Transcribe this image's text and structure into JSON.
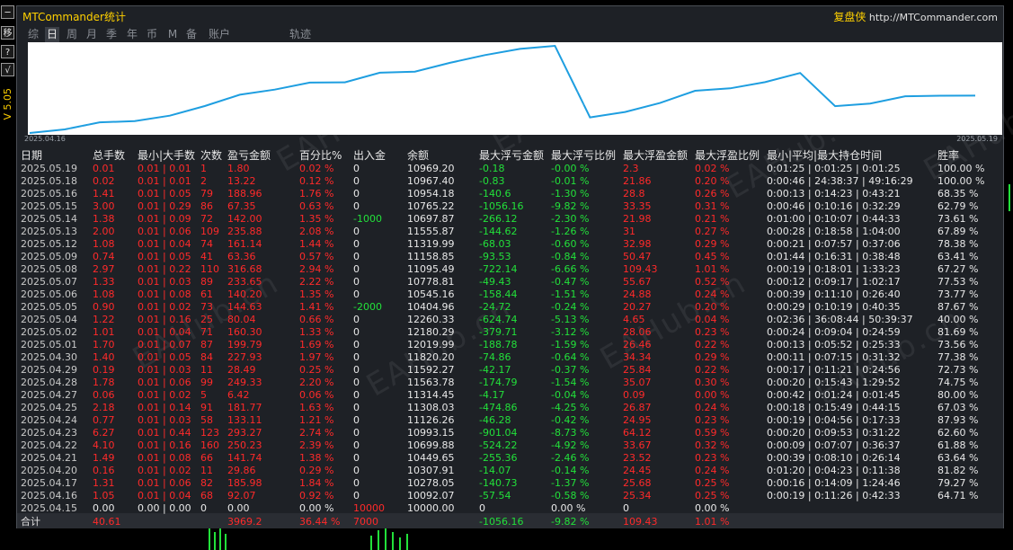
{
  "window": {
    "title": "MTCommander统计",
    "brand_cn": "复盘侠",
    "brand_url": "http://MTCommander.com",
    "version": "V 5.05"
  },
  "sidebar": {
    "buttons": [
      "─",
      "移",
      "?",
      "√"
    ]
  },
  "tabs": [
    {
      "label": "综",
      "active": false
    },
    {
      "label": "日",
      "active": true
    },
    {
      "label": "周",
      "active": false
    },
    {
      "label": "月",
      "active": false
    },
    {
      "label": "季",
      "active": false
    },
    {
      "label": "年",
      "active": false
    },
    {
      "label": "币",
      "active": false
    },
    {
      "label": "M",
      "active": false
    },
    {
      "label": "备",
      "active": false
    },
    {
      "label": "账户",
      "active": false
    },
    {
      "label": "轨迹",
      "active": false
    }
  ],
  "chart_data": {
    "type": "line",
    "x_start_label": "2025.04.16",
    "x_end_label": "2025.05.19",
    "x": [
      "2025.04.15",
      "2025.04.16",
      "2025.04.17",
      "2025.04.20",
      "2025.04.21",
      "2025.04.22",
      "2025.04.23",
      "2025.04.24",
      "2025.04.25",
      "2025.04.27",
      "2025.04.28",
      "2025.04.29",
      "2025.04.30",
      "2025.05.01",
      "2025.05.02",
      "2025.05.04",
      "2025.05.05",
      "2025.05.06",
      "2025.05.07",
      "2025.05.08",
      "2025.05.09",
      "2025.05.12",
      "2025.05.13",
      "2025.05.14",
      "2025.05.15",
      "2025.05.16",
      "2025.05.18",
      "2025.05.19"
    ],
    "values": [
      10000.0,
      10092.07,
      10278.05,
      10307.91,
      10449.65,
      10699.88,
      10993.15,
      11126.26,
      11308.03,
      11314.45,
      11563.78,
      11592.27,
      11820.2,
      12019.99,
      12180.29,
      12260.33,
      10404.96,
      10545.16,
      10778.81,
      11095.49,
      11158.85,
      11319.99,
      11555.87,
      10697.87,
      10765.22,
      10954.18,
      10967.4,
      10969.2
    ],
    "line_color": "#1e9ee0",
    "grid": false
  },
  "watermark": "EAHub.cn",
  "table": {
    "headers": [
      "日期",
      "总手数",
      "最小|大手数",
      "次数",
      "盈亏金额",
      "百分比%",
      "出入金",
      "余额",
      "最大浮亏金额",
      "最大浮亏比例",
      "最大浮盈金额",
      "最大浮盈比例",
      "最小|平均|最大持仓时间",
      "胜率"
    ],
    "rows": [
      [
        "2025.05.19",
        "0.01",
        "0.01 | 0.01",
        "1",
        "1.80",
        "0.02 %",
        "0",
        "10969.20",
        "-0.18",
        "-0.00 %",
        "2.3",
        "0.02 %",
        "0:01:25 | 0:01:25 | 0:01:25",
        "100.00 %"
      ],
      [
        "2025.05.18",
        "0.02",
        "0.01 | 0.01",
        "2",
        "13.22",
        "0.12 %",
        "0",
        "10967.40",
        "-0.83",
        "-0.01 %",
        "21.86",
        "0.20 %",
        "0:00:46 | 24:38:37 | 49:16:29",
        "100.00 %"
      ],
      [
        "2025.05.16",
        "1.41",
        "0.01 | 0.05",
        "79",
        "188.96",
        "1.76 %",
        "0",
        "10954.18",
        "-140.6",
        "-1.30 %",
        "28.8",
        "0.26 %",
        "0:00:13 | 0:14:23 | 0:43:21",
        "68.35 %"
      ],
      [
        "2025.05.15",
        "3.00",
        "0.01 | 0.29",
        "86",
        "67.35",
        "0.63 %",
        "0",
        "10765.22",
        "-1056.16",
        "-9.82 %",
        "33.35",
        "0.31 %",
        "0:00:46 | 0:10:16 | 0:32:29",
        "62.79 %"
      ],
      [
        "2025.05.14",
        "1.38",
        "0.01 | 0.09",
        "72",
        "142.00",
        "1.35 %",
        "-1000",
        "10697.87",
        "-266.12",
        "-2.30 %",
        "21.98",
        "0.21 %",
        "0:01:00 | 0:10:07 | 0:44:33",
        "73.61 %"
      ],
      [
        "2025.05.13",
        "2.00",
        "0.01 | 0.06",
        "109",
        "235.88",
        "2.08 %",
        "0",
        "11555.87",
        "-144.62",
        "-1.26 %",
        "31",
        "0.27 %",
        "0:00:28 | 0:18:58 | 1:04:00",
        "67.89 %"
      ],
      [
        "2025.05.12",
        "1.08",
        "0.01 | 0.04",
        "74",
        "161.14",
        "1.44 %",
        "0",
        "11319.99",
        "-68.03",
        "-0.60 %",
        "32.98",
        "0.29 %",
        "0:00:21 | 0:07:57 | 0:37:06",
        "78.38 %"
      ],
      [
        "2025.05.09",
        "0.74",
        "0.01 | 0.05",
        "41",
        "63.36",
        "0.57 %",
        "0",
        "11158.85",
        "-93.53",
        "-0.84 %",
        "50.47",
        "0.45 %",
        "0:01:44 | 0:16:31 | 0:38:48",
        "63.41 %"
      ],
      [
        "2025.05.08",
        "2.97",
        "0.01 | 0.22",
        "110",
        "316.68",
        "2.94 %",
        "0",
        "11095.49",
        "-722.14",
        "-6.66 %",
        "109.43",
        "1.01 %",
        "0:00:19 | 0:18:01 | 1:33:23",
        "67.27 %"
      ],
      [
        "2025.05.07",
        "1.33",
        "0.01 | 0.03",
        "89",
        "233.65",
        "2.22 %",
        "0",
        "10778.81",
        "-49.43",
        "-0.47 %",
        "55.67",
        "0.52 %",
        "0:00:12 | 0:09:17 | 1:02:17",
        "77.53 %"
      ],
      [
        "2025.05.06",
        "1.08",
        "0.01 | 0.08",
        "61",
        "140.20",
        "1.35 %",
        "0",
        "10545.16",
        "-158.44",
        "-1.51 %",
        "24.88",
        "0.24 %",
        "0:00:39 | 0:11:10 | 0:26:40",
        "73.77 %"
      ],
      [
        "2025.05.05",
        "0.90",
        "0.01 | 0.02",
        "73",
        "144.63",
        "1.41 %",
        "-2000",
        "10404.96",
        "-24.72",
        "-0.24 %",
        "20.27",
        "0.20 %",
        "0:00:29 | 0:10:19 | 0:40:35",
        "87.67 %"
      ],
      [
        "2025.05.04",
        "1.22",
        "0.01 | 0.16",
        "25",
        "80.04",
        "0.66 %",
        "0",
        "12260.33",
        "-624.74",
        "-5.13 %",
        "4.65",
        "0.04 %",
        "0:02:36 | 36:08:44 | 50:39:37",
        "40.00 %"
      ],
      [
        "2025.05.02",
        "1.01",
        "0.01 | 0.04",
        "71",
        "160.30",
        "1.33 %",
        "0",
        "12180.29",
        "-379.71",
        "-3.12 %",
        "28.06",
        "0.23 %",
        "0:00:24 | 0:09:04 | 0:24:59",
        "81.69 %"
      ],
      [
        "2025.05.01",
        "1.70",
        "0.01 | 0.07",
        "87",
        "199.79",
        "1.69 %",
        "0",
        "12019.99",
        "-188.78",
        "-1.59 %",
        "26.46",
        "0.22 %",
        "0:00:13 | 0:05:52 | 0:25:33",
        "73.56 %"
      ],
      [
        "2025.04.30",
        "1.40",
        "0.01 | 0.05",
        "84",
        "227.93",
        "1.97 %",
        "0",
        "11820.20",
        "-74.86",
        "-0.64 %",
        "34.34",
        "0.29 %",
        "0:00:11 | 0:07:15 | 0:31:32",
        "77.38 %"
      ],
      [
        "2025.04.29",
        "0.19",
        "0.01 | 0.03",
        "11",
        "28.49",
        "0.25 %",
        "0",
        "11592.27",
        "-42.17",
        "-0.37 %",
        "25.84",
        "0.22 %",
        "0:00:17 | 0:11:21 | 0:24:56",
        "72.73 %"
      ],
      [
        "2025.04.28",
        "1.78",
        "0.01 | 0.06",
        "99",
        "249.33",
        "2.20 %",
        "0",
        "11563.78",
        "-174.79",
        "-1.54 %",
        "35.07",
        "0.30 %",
        "0:00:20 | 0:15:43 | 1:29:52",
        "74.75 %"
      ],
      [
        "2025.04.27",
        "0.06",
        "0.01 | 0.02",
        "5",
        "6.42",
        "0.06 %",
        "0",
        "11314.45",
        "-4.17",
        "-0.04 %",
        "0.09",
        "0.00 %",
        "0:00:42 | 0:01:24 | 0:01:45",
        "80.00 %"
      ],
      [
        "2025.04.25",
        "2.18",
        "0.01 | 0.14",
        "91",
        "181.77",
        "1.63 %",
        "0",
        "11308.03",
        "-474.86",
        "-4.25 %",
        "26.87",
        "0.24 %",
        "0:00:18 | 0:15:49 | 0:44:15",
        "67.03 %"
      ],
      [
        "2025.04.24",
        "0.77",
        "0.01 | 0.03",
        "58",
        "133.11",
        "1.21 %",
        "0",
        "11126.26",
        "-46.28",
        "-0.42 %",
        "24.95",
        "0.23 %",
        "0:00:19 | 0:04:56 | 0:17:33",
        "87.93 %"
      ],
      [
        "2025.04.23",
        "6.27",
        "0.01 | 0.44",
        "123",
        "293.27",
        "2.74 %",
        "0",
        "10993.15",
        "-901.04",
        "-8.73 %",
        "64.12",
        "0.59 %",
        "0:00:20 | 0:09:53 | 0:31:22",
        "62.60 %"
      ],
      [
        "2025.04.22",
        "4.10",
        "0.01 | 0.16",
        "160",
        "250.23",
        "2.39 %",
        "0",
        "10699.88",
        "-524.22",
        "-4.92 %",
        "33.67",
        "0.32 %",
        "0:00:09 | 0:07:07 | 0:36:37",
        "61.88 %"
      ],
      [
        "2025.04.21",
        "1.49",
        "0.01 | 0.08",
        "66",
        "141.74",
        "1.38 %",
        "0",
        "10449.65",
        "-255.36",
        "-2.46 %",
        "23.52",
        "0.23 %",
        "0:00:39 | 0:08:10 | 0:26:14",
        "63.64 %"
      ],
      [
        "2025.04.20",
        "0.16",
        "0.01 | 0.02",
        "11",
        "29.86",
        "0.29 %",
        "0",
        "10307.91",
        "-14.07",
        "-0.14 %",
        "24.45",
        "0.24 %",
        "0:01:20 | 0:04:23 | 0:11:38",
        "81.82 %"
      ],
      [
        "2025.04.17",
        "1.31",
        "0.01 | 0.06",
        "82",
        "185.98",
        "1.84 %",
        "0",
        "10278.05",
        "-140.73",
        "-1.37 %",
        "25.68",
        "0.25 %",
        "0:00:16 | 0:14:09 | 1:24:46",
        "79.27 %"
      ],
      [
        "2025.04.16",
        "1.05",
        "0.01 | 0.04",
        "68",
        "92.07",
        "0.92 %",
        "0",
        "10092.07",
        "-57.54",
        "-0.58 %",
        "25.34",
        "0.25 %",
        "0:00:19 | 0:11:26 | 0:42:33",
        "64.71 %"
      ],
      [
        "2025.04.15",
        "0.00",
        "0.00 | 0.00",
        "0",
        "0.00",
        "0.00 %",
        "10000",
        "10000.00",
        "0",
        "0.00 %",
        "0",
        "0.00 %",
        "",
        ""
      ]
    ],
    "total": {
      "label": "合计",
      "lots": "40.61",
      "pl": "3969.2",
      "pct": "36.44 %",
      "deposit": "7000",
      "max_float_loss": "-1056.16",
      "max_float_loss_pct": "-9.82 %",
      "max_float_profit": "109.43",
      "max_float_profit_pct": "1.01 %"
    }
  },
  "colors": {
    "panel_bg": "#1e2126",
    "negative": "#22e03a",
    "positive": "#ff2a2a",
    "title": "#ffd000"
  }
}
